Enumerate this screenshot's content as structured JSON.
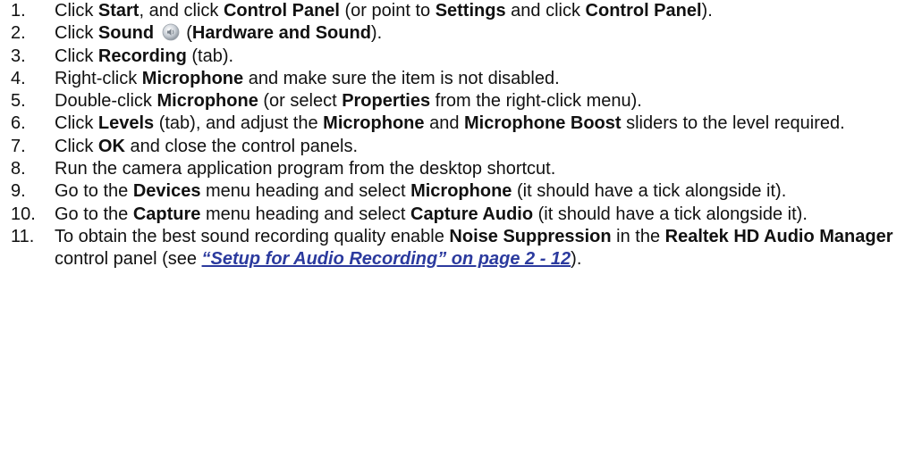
{
  "steps": [
    {
      "num": "1.",
      "parts": [
        {
          "t": "Click "
        },
        {
          "t": "Start",
          "b": true
        },
        {
          "t": ", and click "
        },
        {
          "t": "Control Panel",
          "b": true
        },
        {
          "t": " (or point to "
        },
        {
          "t": "Settings",
          "b": true
        },
        {
          "t": " and click "
        },
        {
          "t": "Control Panel",
          "b": true
        },
        {
          "t": ")."
        }
      ]
    },
    {
      "num": "2.",
      "parts": [
        {
          "t": "Click "
        },
        {
          "t": "Sound",
          "b": true
        },
        {
          "t": " "
        },
        {
          "icon": "sound-icon"
        },
        {
          "t": " ("
        },
        {
          "t": "Hardware and Sound",
          "b": true
        },
        {
          "t": ")."
        }
      ]
    },
    {
      "num": "3.",
      "parts": [
        {
          "t": "Click "
        },
        {
          "t": "Recording",
          "b": true
        },
        {
          "t": " (tab)."
        }
      ]
    },
    {
      "num": "4.",
      "parts": [
        {
          "t": "Right-click "
        },
        {
          "t": "Microphone",
          "b": true
        },
        {
          "t": " and make sure the item is not disabled."
        }
      ]
    },
    {
      "num": "5.",
      "parts": [
        {
          "t": "Double-click "
        },
        {
          "t": "Microphone",
          "b": true
        },
        {
          "t": " (or select "
        },
        {
          "t": "Properties",
          "b": true
        },
        {
          "t": " from the right-click menu)."
        }
      ]
    },
    {
      "num": "6.",
      "parts": [
        {
          "t": "Click "
        },
        {
          "t": "Levels",
          "b": true
        },
        {
          "t": " (tab), and adjust the "
        },
        {
          "t": "Microphone",
          "b": true
        },
        {
          "t": " and "
        },
        {
          "t": "Microphone Boost",
          "b": true
        },
        {
          "t": " sliders to the level required."
        }
      ]
    },
    {
      "num": "7.",
      "parts": [
        {
          "t": "Click "
        },
        {
          "t": "OK",
          "b": true
        },
        {
          "t": " and close the control panels."
        }
      ]
    },
    {
      "num": "8.",
      "parts": [
        {
          "t": "Run the camera application program from the desktop shortcut."
        }
      ]
    },
    {
      "num": "9.",
      "parts": [
        {
          "t": "Go to the "
        },
        {
          "t": "Devices",
          "b": true
        },
        {
          "t": " menu heading and select "
        },
        {
          "t": "Microphone",
          "b": true
        },
        {
          "t": " (it should have a tick alongside it)."
        }
      ]
    },
    {
      "num": "10.",
      "parts": [
        {
          "t": "Go to the "
        },
        {
          "t": "Capture",
          "b": true
        },
        {
          "t": " menu heading and select "
        },
        {
          "t": "Capture Audio",
          "b": true
        },
        {
          "t": " (it should have a tick alongside it)."
        }
      ]
    },
    {
      "num": "11.",
      "parts": [
        {
          "t": "To obtain the best sound recording quality enable "
        },
        {
          "t": "Noise Suppression",
          "b": true
        },
        {
          "t": " in the "
        },
        {
          "t": "Realtek HD Audio Manager",
          "b": true
        },
        {
          "t": " control panel (see "
        },
        {
          "t": "“Setup for Audio Recording” on page 2 - 12",
          "link": true
        },
        {
          "t": ")."
        }
      ]
    }
  ],
  "colors": {
    "text": "#111111",
    "link": "#2b3a9e"
  }
}
